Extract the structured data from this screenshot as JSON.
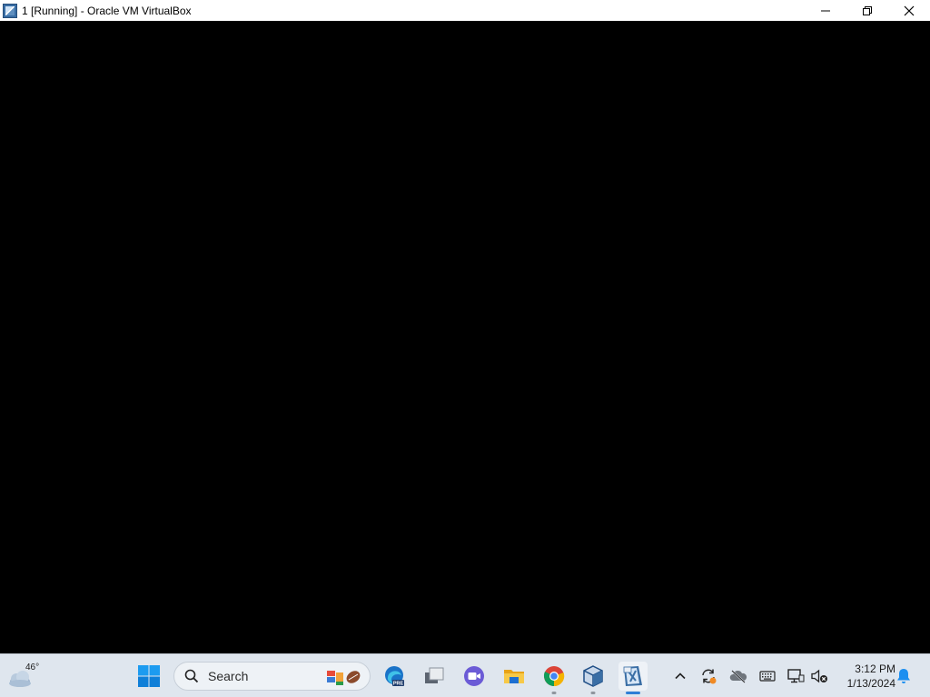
{
  "window": {
    "title": "1 [Running] - Oracle VM VirtualBox",
    "controls": {
      "minimize": "minimize",
      "restore": "restore",
      "close": "close"
    }
  },
  "taskbar": {
    "weather": {
      "temperature": "46°",
      "icon": "partly-cloudy-icon"
    },
    "search": {
      "label": "Search"
    },
    "apps": [
      {
        "name": "start",
        "icon": "windows-logo-icon"
      },
      {
        "name": "edge-preview",
        "icon": "edge-icon",
        "badge": "PRE"
      },
      {
        "name": "task-view",
        "icon": "task-view-icon"
      },
      {
        "name": "teams-meet",
        "icon": "video-call-icon"
      },
      {
        "name": "file-explorer",
        "icon": "folder-icon"
      },
      {
        "name": "chrome",
        "icon": "chrome-icon"
      },
      {
        "name": "virtualbox-manager",
        "icon": "virtualbox-icon"
      },
      {
        "name": "virtualbox-vm",
        "icon": "vm-window-icon"
      }
    ],
    "tray": [
      "chevron-up-icon",
      "sync-icon",
      "onedrive-offline-icon",
      "keyboard-icon",
      "network-icon",
      "volume-muted-icon"
    ],
    "clock": {
      "time": "3:12 PM",
      "date": "1/13/2024"
    }
  },
  "colors": {
    "taskbar_bg": "#dfe6ee",
    "vm_bg": "#000000",
    "accent": "#2f7fd6"
  }
}
